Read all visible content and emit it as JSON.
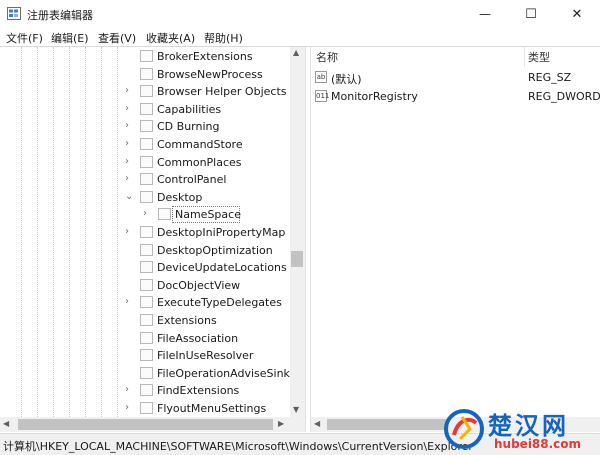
{
  "window": {
    "title": "注册表编辑器",
    "minimize_glyph": "—",
    "maximize_glyph": "☐",
    "close_glyph": "✕"
  },
  "menu": [
    "文件(F)",
    "编辑(E)",
    "查看(V)",
    "收藏夹(A)",
    "帮助(H)"
  ],
  "tree": {
    "items": [
      {
        "label": "BrokerExtensions",
        "expandable": false
      },
      {
        "label": "BrowseNewProcess",
        "expandable": false
      },
      {
        "label": "Browser Helper Objects",
        "expandable": true
      },
      {
        "label": "Capabilities",
        "expandable": true
      },
      {
        "label": "CD Burning",
        "expandable": true
      },
      {
        "label": "CommandStore",
        "expandable": true
      },
      {
        "label": "CommonPlaces",
        "expandable": true
      },
      {
        "label": "ControlPanel",
        "expandable": true
      },
      {
        "label": "Desktop",
        "expandable": true,
        "expanded": true
      },
      {
        "label": "NameSpace",
        "expandable": true,
        "child": true,
        "selected": true
      },
      {
        "label": "DesktopIniPropertyMap",
        "expandable": true
      },
      {
        "label": "DesktopOptimization",
        "expandable": false
      },
      {
        "label": "DeviceUpdateLocations",
        "expandable": false
      },
      {
        "label": "DocObjectView",
        "expandable": false
      },
      {
        "label": "ExecuteTypeDelegates",
        "expandable": true
      },
      {
        "label": "Extensions",
        "expandable": false
      },
      {
        "label": "FileAssociation",
        "expandable": false
      },
      {
        "label": "FileInUseResolver",
        "expandable": false
      },
      {
        "label": "FileOperationAdviseSinks",
        "expandable": false
      },
      {
        "label": "FindExtensions",
        "expandable": true
      },
      {
        "label": "FlyoutMenuSettings",
        "expandable": true
      }
    ]
  },
  "values_list": {
    "columns": {
      "name": "名称",
      "type": "类型"
    },
    "rows": [
      {
        "icon": "ab",
        "icon_name": "string-value-icon",
        "name": "(默认)",
        "type": "REG_SZ"
      },
      {
        "icon": "011",
        "icon_name": "binary-value-icon",
        "name": "MonitorRegistry",
        "type": "REG_DWORD"
      }
    ]
  },
  "status": {
    "path": "计算机\\HKEY_LOCAL_MACHINE\\SOFTWARE\\Microsoft\\Windows\\CurrentVersion\\Explorer\\Desktop\\NameSpace"
  },
  "watermark": {
    "text": "楚汉网",
    "url": "hubei88.com",
    "colors": {
      "main": "#1565c0",
      "accent": "#e53935"
    }
  }
}
